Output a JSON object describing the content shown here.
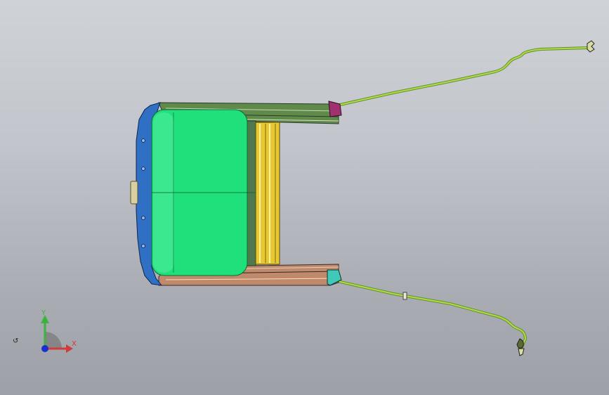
{
  "viewport": {
    "background_top": "#cfd3d8",
    "background_bottom": "#9da1a7"
  },
  "model": {
    "parts": [
      {
        "name": "glass-panel",
        "color": "#1fe07a"
      },
      {
        "name": "front-frame",
        "color": "#2f6fc4"
      },
      {
        "name": "left-rail",
        "color": "#5f8a4a"
      },
      {
        "name": "right-rail",
        "color": "#c08a6a"
      },
      {
        "name": "sunshade",
        "color": "#f0d23a"
      },
      {
        "name": "drain-hose",
        "color": "#8fd43a"
      },
      {
        "name": "rear-bracket-left",
        "color": "#b03a8a"
      },
      {
        "name": "rear-bracket-right",
        "color": "#3ad0c0"
      }
    ]
  },
  "triad": {
    "y_label": "Y",
    "x_label": "X",
    "y_color": "#3fb13f",
    "x_color": "#d33a3a",
    "origin_color": "#1a2fd0"
  },
  "view_indicator": {
    "glyph": "↺"
  }
}
